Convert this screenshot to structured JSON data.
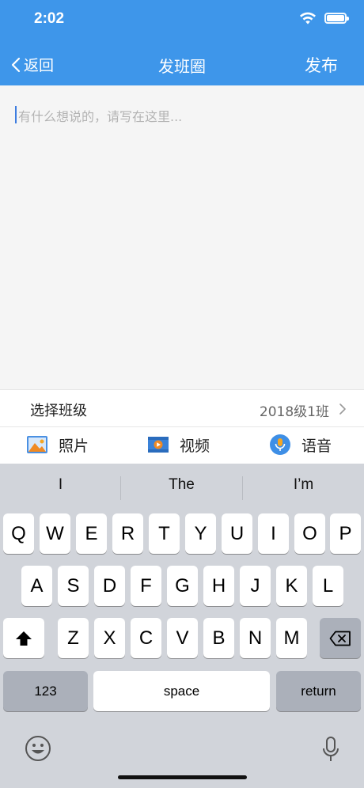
{
  "status": {
    "time": "2:02"
  },
  "nav": {
    "back_label": "返回",
    "title": "发班圈",
    "publish_label": "发布"
  },
  "compose": {
    "placeholder": "有什么想说的，请写在这里..."
  },
  "class_selector": {
    "label": "选择班级",
    "value": "2018级1班"
  },
  "media": [
    {
      "label": "照片",
      "icon": "photo-icon"
    },
    {
      "label": "视频",
      "icon": "video-icon"
    },
    {
      "label": "语音",
      "icon": "voice-icon"
    }
  ],
  "keyboard": {
    "suggestions": [
      "I",
      "The",
      "I’m"
    ],
    "row1": [
      "Q",
      "W",
      "E",
      "R",
      "T",
      "Y",
      "U",
      "I",
      "O",
      "P"
    ],
    "row2": [
      "A",
      "S",
      "D",
      "F",
      "G",
      "H",
      "J",
      "K",
      "L"
    ],
    "row3": [
      "Z",
      "X",
      "C",
      "V",
      "B",
      "N",
      "M"
    ],
    "numbers_label": "123",
    "space_label": "space",
    "return_label": "return"
  },
  "colors": {
    "header": "#3e96ea",
    "keyboard_bg": "#d1d4da",
    "caret": "#3e7de0"
  }
}
